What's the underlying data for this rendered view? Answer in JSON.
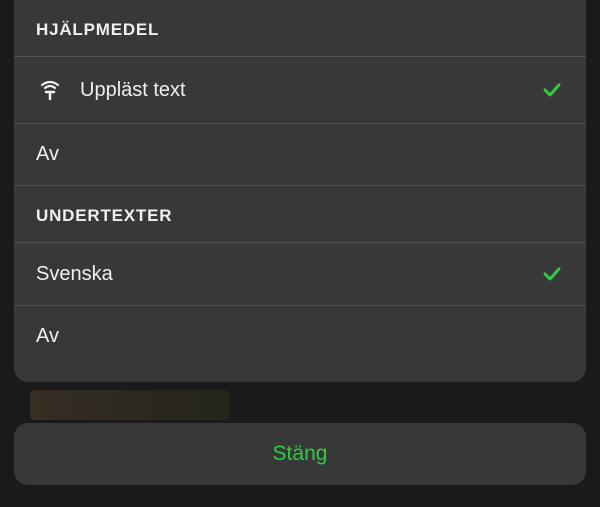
{
  "sections": {
    "accessibility": {
      "header": "HJÄLPMEDEL",
      "options": {
        "tts": {
          "label": "Uppläst text",
          "selected": true,
          "hasIcon": true
        },
        "off": {
          "label": "Av",
          "selected": false,
          "hasIcon": false
        }
      }
    },
    "subtitles": {
      "header": "UNDERTEXTER",
      "options": {
        "swedish": {
          "label": "Svenska",
          "selected": true
        },
        "off": {
          "label": "Av",
          "selected": false
        }
      }
    }
  },
  "close_label": "Stäng",
  "colors": {
    "accent": "#2ecc40",
    "text": "#f0f0f0",
    "sheet_bg": "rgba(58,58,58,0.95)"
  }
}
